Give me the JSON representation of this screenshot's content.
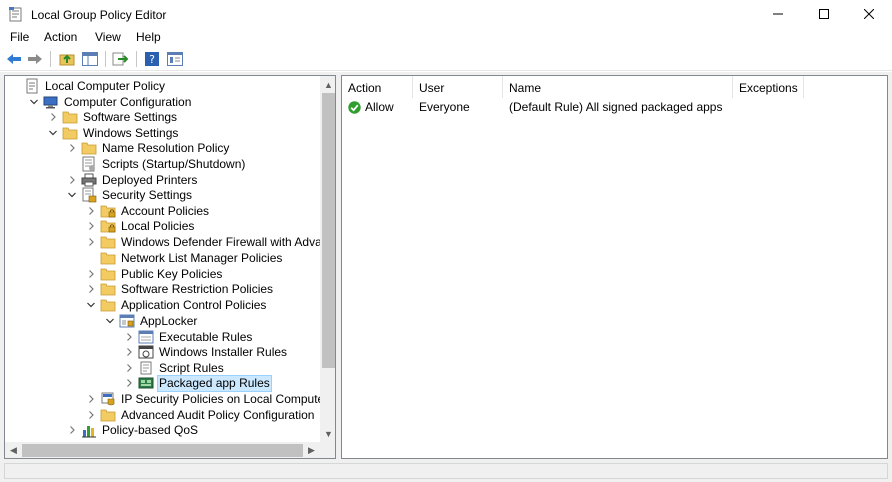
{
  "window": {
    "title": "Local Group Policy Editor"
  },
  "menu": [
    "File",
    "Action",
    "View",
    "Help"
  ],
  "toolbar": {
    "icons": [
      "back-arrow-icon",
      "forward-arrow-icon",
      "up-folder-icon",
      "show-hide-tree-icon",
      "export-list-icon",
      "help-icon",
      "properties-icon"
    ]
  },
  "tree": {
    "items": [
      {
        "label": "Local Computer Policy",
        "icon": "policy-icon",
        "expander": "none"
      },
      {
        "label": "Computer Configuration",
        "icon": "computer-icon",
        "expander": "expanded"
      },
      {
        "label": "Software Settings",
        "icon": "folder-icon",
        "expander": "collapsed"
      },
      {
        "label": "Windows Settings",
        "icon": "folder-icon",
        "expander": "expanded"
      },
      {
        "label": "Name Resolution Policy",
        "icon": "folder-icon",
        "expander": "collapsed"
      },
      {
        "label": "Scripts (Startup/Shutdown)",
        "icon": "script-icon",
        "expander": "none"
      },
      {
        "label": "Deployed Printers",
        "icon": "printer-icon",
        "expander": "collapsed"
      },
      {
        "label": "Security Settings",
        "icon": "security-icon",
        "expander": "expanded"
      },
      {
        "label": "Account Policies",
        "icon": "lock-folder-icon",
        "expander": "collapsed"
      },
      {
        "label": "Local Policies",
        "icon": "lock-folder-icon",
        "expander": "collapsed"
      },
      {
        "label": "Windows Defender Firewall with Advanc",
        "icon": "folder-icon",
        "expander": "collapsed"
      },
      {
        "label": "Network List Manager Policies",
        "icon": "folder-icon",
        "expander": "none"
      },
      {
        "label": "Public Key Policies",
        "icon": "folder-icon",
        "expander": "collapsed"
      },
      {
        "label": "Software Restriction Policies",
        "icon": "folder-icon",
        "expander": "collapsed"
      },
      {
        "label": "Application Control Policies",
        "icon": "folder-icon",
        "expander": "expanded"
      },
      {
        "label": "AppLocker",
        "icon": "applocker-icon",
        "expander": "expanded"
      },
      {
        "label": "Executable Rules",
        "icon": "exe-rules-icon",
        "expander": "collapsed"
      },
      {
        "label": "Windows Installer Rules",
        "icon": "installer-rules-icon",
        "expander": "collapsed"
      },
      {
        "label": "Script Rules",
        "icon": "script-rules-icon",
        "expander": "collapsed"
      },
      {
        "label": "Packaged app Rules",
        "icon": "packaged-app-icon",
        "expander": "collapsed",
        "selected": true
      },
      {
        "label": "IP Security Policies on Local Computer",
        "icon": "ip-security-icon",
        "expander": "collapsed"
      },
      {
        "label": "Advanced Audit Policy Configuration",
        "icon": "folder-icon",
        "expander": "collapsed"
      },
      {
        "label": "Policy-based QoS",
        "icon": "chart-icon",
        "expander": "collapsed"
      }
    ]
  },
  "list": {
    "columns": [
      "Action",
      "User",
      "Name",
      "Exceptions"
    ],
    "rows": [
      {
        "action": "Allow",
        "user": "Everyone",
        "name": "(Default Rule) All signed packaged apps",
        "exceptions": ""
      }
    ]
  },
  "colors": {
    "selection": "#cce8ff",
    "selection_border": "#99d1ff",
    "allow_green": "#2f9e2f"
  }
}
